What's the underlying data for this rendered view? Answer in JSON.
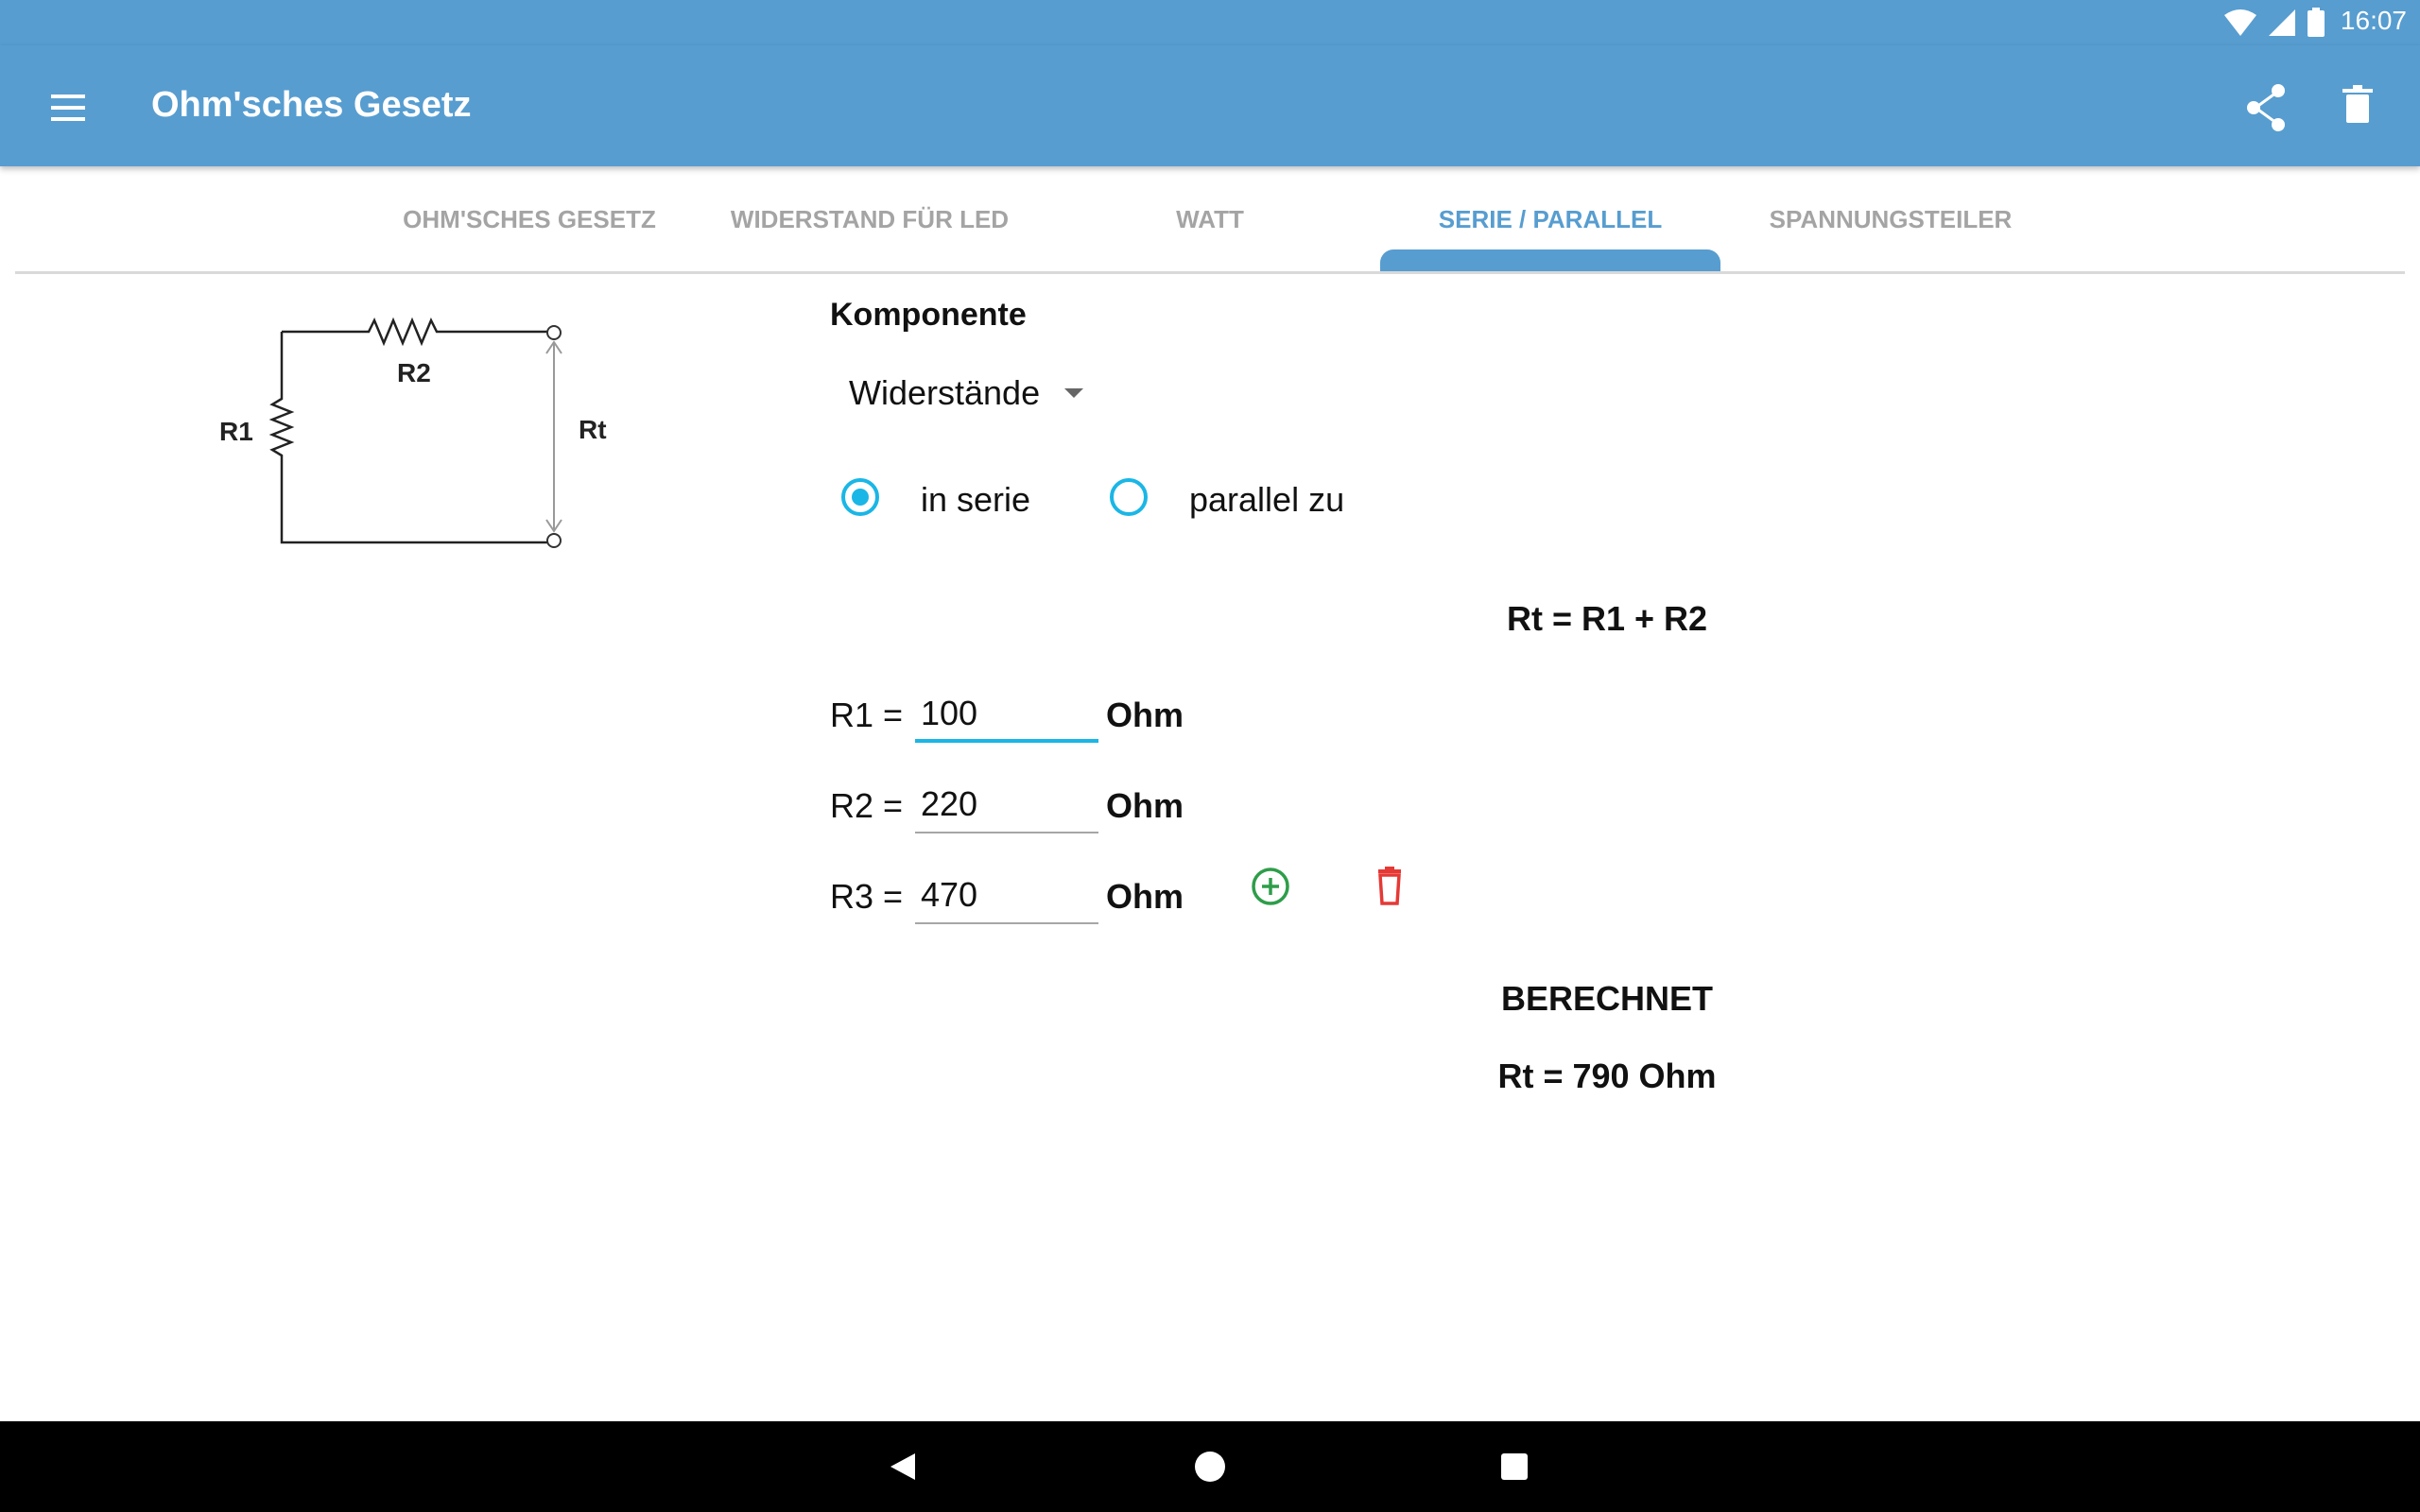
{
  "status_bar": {
    "time": "16:07",
    "icons": [
      "wifi-icon",
      "cell-signal-icon",
      "battery-icon"
    ]
  },
  "app_bar": {
    "title": "Ohm'sches Gesetz",
    "icons": [
      "menu-icon",
      "share-icon",
      "delete-icon"
    ],
    "color": "#579dd0"
  },
  "tabs": [
    {
      "label": "OHM'SCHES GESETZ",
      "active": false
    },
    {
      "label": "WIDERSTAND FÜR LED",
      "active": false
    },
    {
      "label": "WATT",
      "active": false
    },
    {
      "label": "SERIE / PARALLEL",
      "active": true
    },
    {
      "label": "SPANNUNGSTEILER",
      "active": false
    }
  ],
  "circuit": {
    "labels": {
      "r1": "R1",
      "r2": "R2",
      "rt": "Rt"
    }
  },
  "form": {
    "komponente_label": "Komponente",
    "component_value": "Widerstände",
    "radios": [
      {
        "label": "in serie",
        "checked": true
      },
      {
        "label": "parallel zu",
        "checked": false
      }
    ],
    "formula": "Rt = R1 + R2",
    "rows": [
      {
        "label": "R1 =",
        "value": "100",
        "unit": "Ohm"
      },
      {
        "label": "R2 =",
        "value": "220",
        "unit": "Ohm"
      },
      {
        "label": "R3 =",
        "value": "470",
        "unit": "Ohm"
      }
    ],
    "actions": {
      "add_icon": "add-circle-icon",
      "remove_icon": "trash-icon"
    },
    "result_heading": "BERECHNET",
    "result_value": "Rt = 790 Ohm"
  },
  "nav_bar": {
    "icons": [
      "back-icon",
      "home-icon",
      "recents-icon"
    ]
  },
  "colors": {
    "accent": "#579dd0",
    "radio": "#1ab6e6",
    "add": "#2e9d4a",
    "remove": "#e53935"
  }
}
